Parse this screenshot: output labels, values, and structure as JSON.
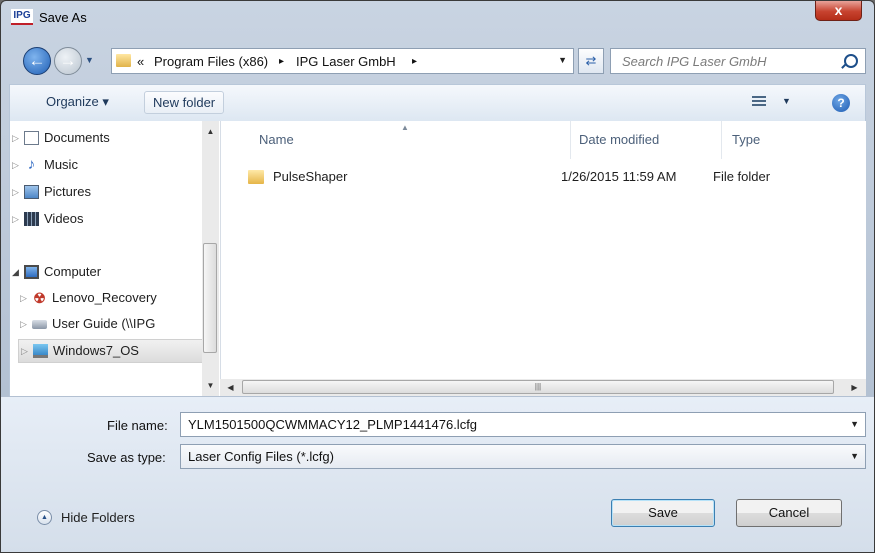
{
  "window": {
    "title": "Save As",
    "app_logo": "IPG",
    "close_label": "x"
  },
  "address": {
    "back_glyph": "←",
    "crumbs": [
      "«",
      "Program Files (x86)",
      "▸",
      "IPG Laser GmbH",
      "▸"
    ],
    "search_placeholder": "Search IPG Laser GmbH"
  },
  "toolbar": {
    "organize_label": "Organize ▾",
    "new_folder_label": "New folder"
  },
  "nav": {
    "items": [
      {
        "label": "Documents",
        "icon": "documents-icon"
      },
      {
        "label": "Music",
        "icon": "music-icon"
      },
      {
        "label": "Pictures",
        "icon": "pictures-icon"
      },
      {
        "label": "Videos",
        "icon": "videos-icon"
      },
      {
        "label": "Computer",
        "icon": "computer-icon"
      },
      {
        "label": "Lenovo_Recovery",
        "icon": "recovery-drive-icon"
      },
      {
        "label": "User Guide (\\\\IPG",
        "icon": "network-drive-icon"
      },
      {
        "label": "Windows7_OS",
        "icon": "os-drive-icon",
        "selected": true
      }
    ]
  },
  "columns": {
    "name": "Name",
    "date_modified": "Date modified",
    "type": "Type"
  },
  "files": [
    {
      "name": "PulseShaper",
      "date_modified": "1/26/2015 11:59 AM",
      "type": "File folder"
    }
  ],
  "form": {
    "file_name_label": "File name:",
    "file_name_value": "YLM1501500QCWMMACY12_PLMP1441476.lcfg",
    "save_as_type_label": "Save as type:",
    "save_as_type_value": "Laser Config Files (*.lcfg)"
  },
  "footer": {
    "hide_folders_label": "Hide Folders",
    "save_label": "Save",
    "cancel_label": "Cancel"
  },
  "colors": {
    "title_gradient": "#c9d4e2",
    "close_button": "#c7432f",
    "selection": "#dcdcdc",
    "accent": "#1d5bb2"
  }
}
